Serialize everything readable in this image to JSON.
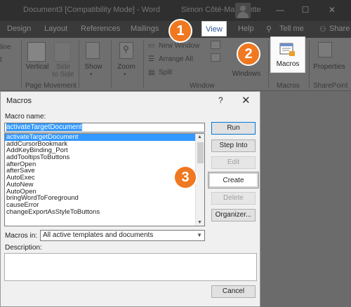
{
  "titlebar": {
    "document_title": "Document3 [Compatibility Mode] - Word",
    "user_name": "Simon Côté-Massicotte",
    "controls": [
      "—",
      "☐",
      "✕"
    ]
  },
  "tabs": [
    {
      "label": "Design"
    },
    {
      "label": "Layout"
    },
    {
      "label": "References"
    },
    {
      "label": "Mailings"
    },
    {
      "label": "View"
    },
    {
      "label": "Help"
    },
    {
      "label": "Tell me"
    },
    {
      "label": "Share"
    }
  ],
  "ribbon": {
    "left_cut_1": "line",
    "left_cut_2": "t",
    "vertical_label": "Vertical",
    "side_to_side_label": "Side\nto Side",
    "page_movement_label": "Page Movement",
    "show_label": "Show",
    "zoom_label": "Zoom",
    "new_window_label": "New Window",
    "arrange_all_label": "Arrange All",
    "split_label": "Split",
    "window_group_label": "Window",
    "windows_label": "Windows",
    "macros_label": "Macros",
    "macros_group_label": "Macros",
    "properties_label": "Properties",
    "sharepoint_group_label": "SharePoint"
  },
  "dialog": {
    "title": "Macros",
    "help": "?",
    "close": "✕",
    "macro_name_label": "Macro name:",
    "macro_name_value": "activateTargetDocument",
    "macros": [
      "activateTargetDocument",
      "addCursorBookmark",
      "AddKeyBinding_Port",
      "addTooltipsToButtons",
      "afterOpen",
      "afterSave",
      "AutoExec",
      "AutoNew",
      "AutoOpen",
      "bringWordToForeground",
      "causeError",
      "changeExportAsStyleToButtons"
    ],
    "buttons": {
      "run": "Run",
      "step_into": "Step Into",
      "edit": "Edit",
      "create": "Create",
      "delete": "Delete",
      "organizer": "Organizer...",
      "cancel": "Cancel"
    },
    "macros_in_label": "Macros in:",
    "macros_in_value": "All active templates and documents",
    "description_label": "Description:"
  },
  "badges": [
    "1",
    "2",
    "3"
  ],
  "colors": {
    "badge": "#f07820",
    "selection": "#3399ff",
    "view_tab_text": "#2b579a"
  }
}
